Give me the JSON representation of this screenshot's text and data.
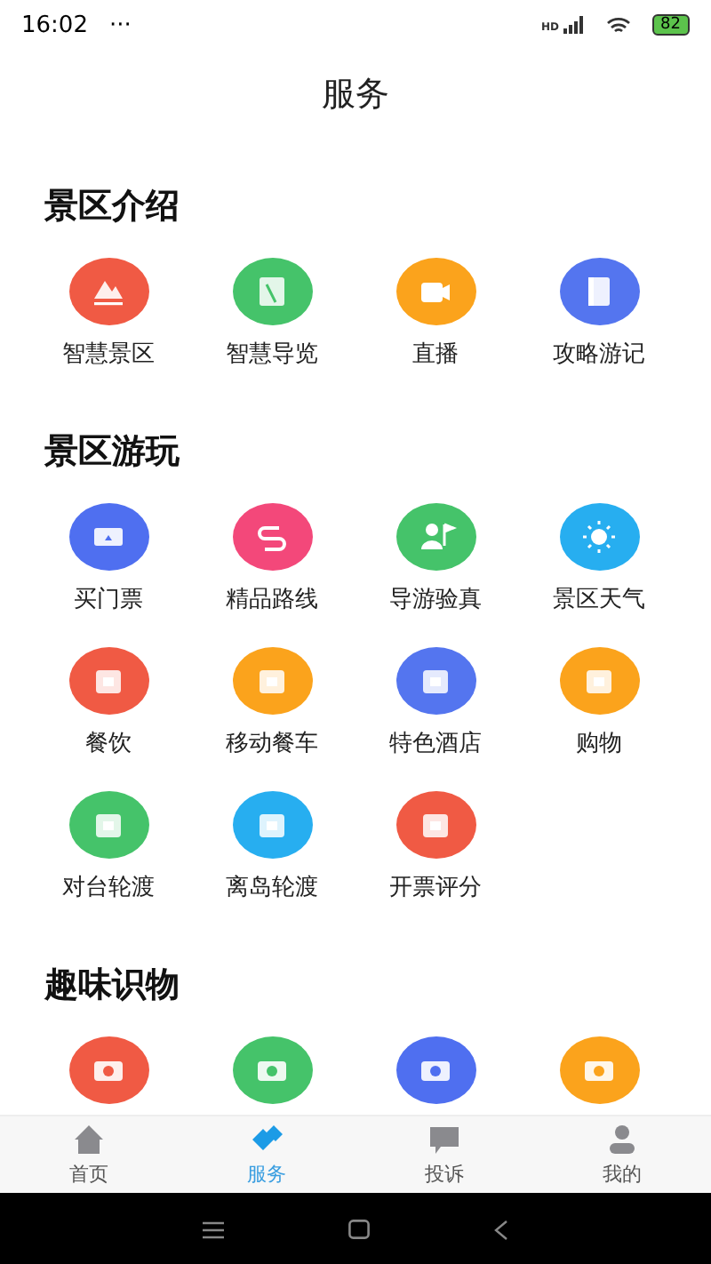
{
  "status_bar": {
    "time": "16:02",
    "menu_dots": "···",
    "signal_label": "HD",
    "battery": "82"
  },
  "header": {
    "title": "服务"
  },
  "sections": [
    {
      "title": "景区介绍",
      "items": [
        {
          "label": "智慧景区",
          "color": "#f05a44"
        },
        {
          "label": "智慧导览",
          "color": "#45c36a"
        },
        {
          "label": "直播",
          "color": "#fba31c"
        },
        {
          "label": "攻略游记",
          "color": "#5475ef"
        }
      ]
    },
    {
      "title": "景区游玩",
      "items": [
        {
          "label": "买门票",
          "color": "#4f6ff0"
        },
        {
          "label": "精品路线",
          "color": "#f3487a"
        },
        {
          "label": "导游验真",
          "color": "#45c36a"
        },
        {
          "label": "景区天气",
          "color": "#27aef0"
        },
        {
          "label": "餐饮",
          "color": "#f05a44"
        },
        {
          "label": "移动餐车",
          "color": "#fba31c"
        },
        {
          "label": "特色酒店",
          "color": "#5475ef"
        },
        {
          "label": "购物",
          "color": "#fba31c"
        },
        {
          "label": "对台轮渡",
          "color": "#45c36a"
        },
        {
          "label": "离岛轮渡",
          "color": "#27aef0"
        },
        {
          "label": "开票评分",
          "color": "#f05a44"
        }
      ]
    },
    {
      "title": "趣味识物",
      "items": [
        {
          "color": "#f05a44"
        },
        {
          "color": "#45c36a"
        },
        {
          "color": "#4f6ff0"
        },
        {
          "color": "#fba31c"
        }
      ]
    }
  ],
  "tab_bar": [
    {
      "label": "首页",
      "selected": false
    },
    {
      "label": "服务",
      "selected": true
    },
    {
      "label": "投诉",
      "selected": false
    },
    {
      "label": "我的",
      "selected": false
    }
  ]
}
